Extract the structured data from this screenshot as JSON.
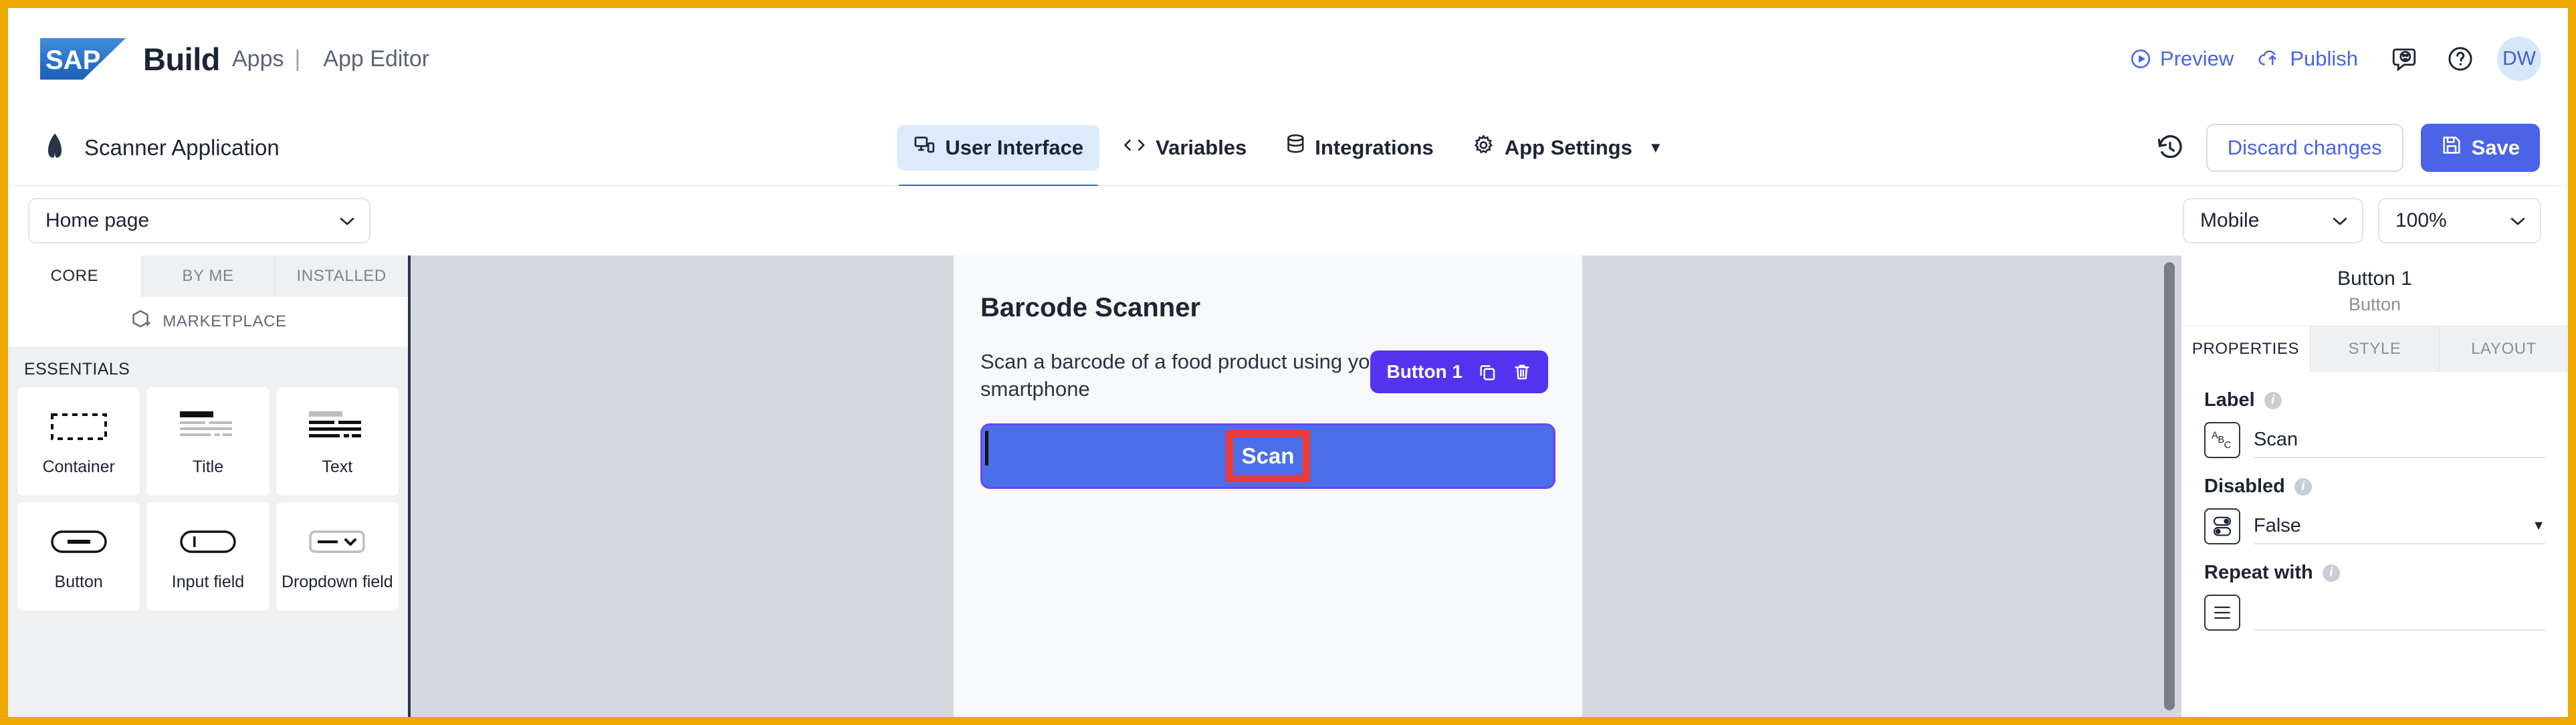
{
  "header": {
    "brand": "Build",
    "crumb_apps": "Apps",
    "separator": "|",
    "crumb_editor": "App Editor",
    "preview": "Preview",
    "publish": "Publish",
    "feedback_icon": "feedback-smiley-icon",
    "help_icon": "help-question-icon",
    "avatar_initials": "DW"
  },
  "toolbar": {
    "app_name": "Scanner Application",
    "app_logo_icon": "app-logo-icon",
    "tabs": [
      {
        "label": "User Interface",
        "icon": "user-interface-icon",
        "active": true
      },
      {
        "label": "Variables",
        "icon": "code-brackets-icon",
        "active": false
      },
      {
        "label": "Integrations",
        "icon": "database-stack-icon",
        "active": false
      },
      {
        "label": "App Settings",
        "icon": "gear-icon",
        "active": false,
        "caret": "▼"
      }
    ],
    "history_icon": "history-clock-icon",
    "discard_label": "Discard changes",
    "save_label": "Save",
    "save_icon": "floppy-disk-icon"
  },
  "page_bar": {
    "page_value": "Home page",
    "device_value": "Mobile",
    "zoom_value": "100%",
    "chevron": "⌄"
  },
  "left_panel": {
    "tabs": [
      {
        "label": "CORE",
        "active": true
      },
      {
        "label": "BY ME",
        "active": false
      },
      {
        "label": "INSTALLED",
        "active": false
      }
    ],
    "marketplace_label": "MARKETPLACE",
    "marketplace_icon": "marketplace-cube-icon",
    "section_title": "ESSENTIALS",
    "components": [
      {
        "name": "Container",
        "icon": "container-dashed-icon"
      },
      {
        "name": "Title",
        "icon": "title-lines-icon"
      },
      {
        "name": "Text",
        "icon": "text-lines-icon"
      },
      {
        "name": "Button",
        "icon": "button-pill-icon"
      },
      {
        "name": "Input field",
        "icon": "input-field-icon"
      },
      {
        "name": "Dropdown field",
        "icon": "dropdown-field-icon"
      }
    ]
  },
  "canvas": {
    "app_title": "Barcode Scanner",
    "app_description": "Scan a barcode of a food product using your smartphone",
    "scan_button_label": "Scan",
    "selection_badge": {
      "label": "Button 1",
      "duplicate_icon": "duplicate-icon",
      "delete_icon": "trash-icon"
    },
    "highlight_color": "#ef3b37",
    "button_color": "#4a6fe8",
    "selection_color": "#5433f0"
  },
  "right_panel": {
    "component_name": "Button 1",
    "component_type": "Button",
    "tabs": [
      {
        "label": "PROPERTIES",
        "active": true
      },
      {
        "label": "STYLE",
        "active": false
      },
      {
        "label": "LAYOUT",
        "active": false
      }
    ],
    "properties": [
      {
        "label": "Label",
        "type_icon": "abc-text-icon",
        "value": "Scan",
        "has_caret": false
      },
      {
        "label": "Disabled",
        "type_icon": "toggle-boolean-icon",
        "value": "False",
        "has_caret": true
      },
      {
        "label": "Repeat with",
        "type_icon": "list-icon",
        "value": "",
        "has_caret": false
      }
    ]
  }
}
